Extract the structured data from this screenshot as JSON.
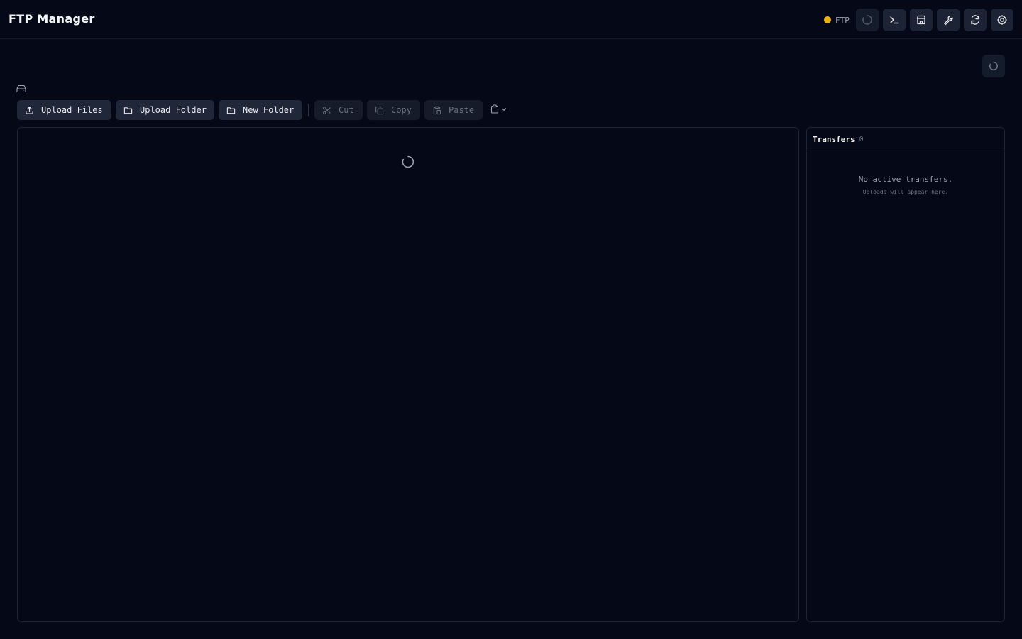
{
  "header": {
    "title": "FTP Manager",
    "status": {
      "label": "FTP",
      "color": "#eab308"
    },
    "buttons": [
      {
        "name": "loading-indicator",
        "icon": "spinner-icon"
      },
      {
        "name": "terminal-button",
        "icon": "terminal-icon"
      },
      {
        "name": "store-button",
        "icon": "store-icon"
      },
      {
        "name": "tools-button",
        "icon": "wrench-icon"
      },
      {
        "name": "refresh-button",
        "icon": "refresh-icon"
      },
      {
        "name": "settings-button",
        "icon": "gear-icon"
      }
    ]
  },
  "breadcrumb": {
    "icon": "drive-icon"
  },
  "toolbar": {
    "upload_files": "Upload Files",
    "upload_folder": "Upload Folder",
    "new_folder": "New Folder",
    "cut": "Cut",
    "copy": "Copy",
    "paste": "Paste",
    "clipboard_icon": "clipboard-icon"
  },
  "files": {
    "state": "loading"
  },
  "transfers": {
    "title": "Transfers",
    "count": "0",
    "empty_message": "No active transfers.",
    "empty_hint": "Uploads will appear here."
  },
  "colors": {
    "background": "#050816",
    "button": "#1f2738",
    "border": "#1e2535"
  }
}
